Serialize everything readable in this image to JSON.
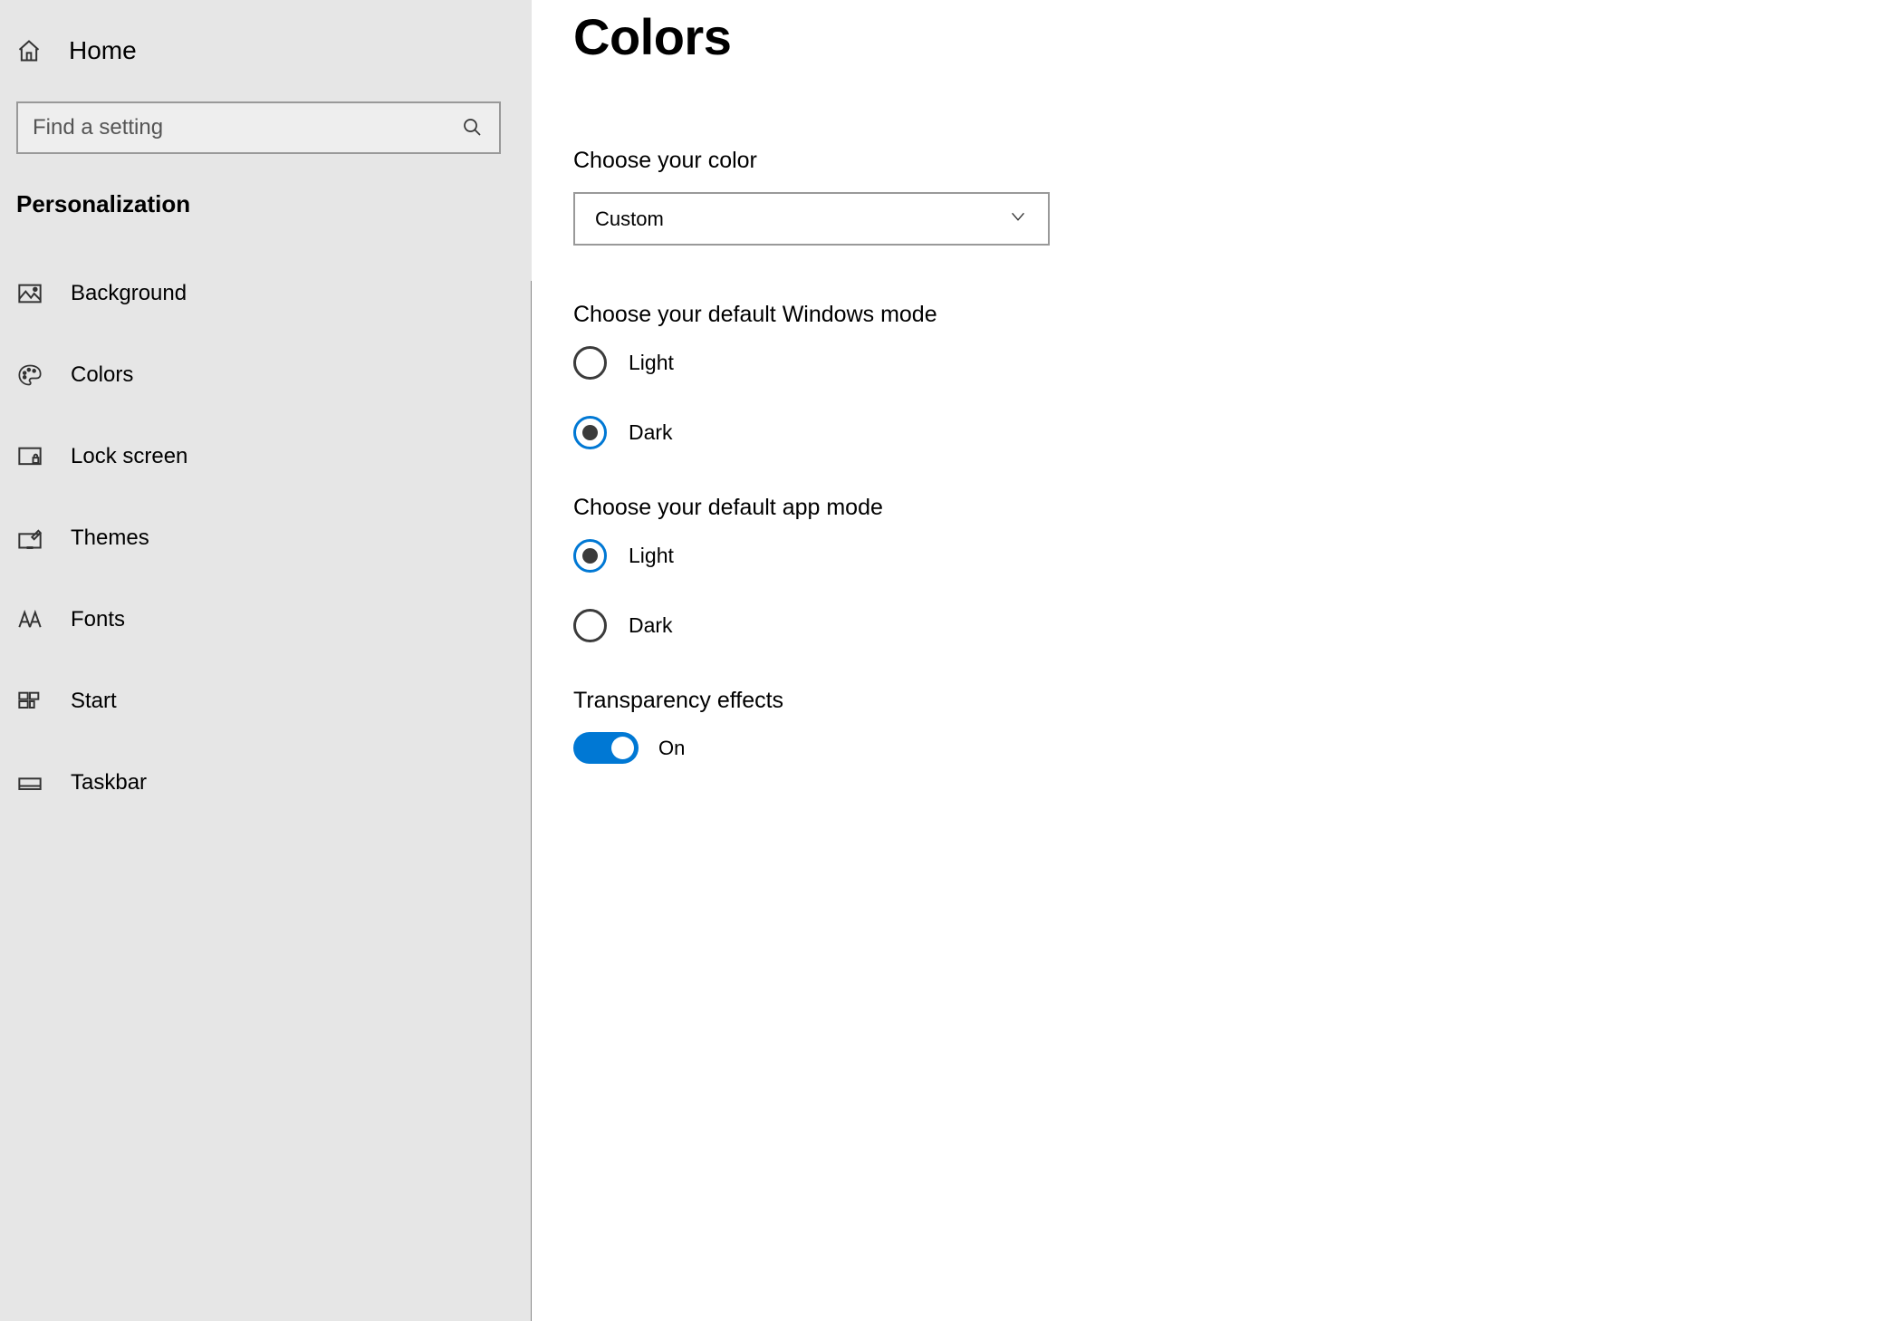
{
  "sidebar": {
    "home_label": "Home",
    "search_placeholder": "Find a setting",
    "section_title": "Personalization",
    "items": [
      {
        "label": "Background"
      },
      {
        "label": "Colors"
      },
      {
        "label": "Lock screen"
      },
      {
        "label": "Themes"
      },
      {
        "label": "Fonts"
      },
      {
        "label": "Start"
      },
      {
        "label": "Taskbar"
      }
    ]
  },
  "main": {
    "page_title": "Colors",
    "choose_color_label": "Choose your color",
    "choose_color_value": "Custom",
    "windows_mode": {
      "label": "Choose your default Windows mode",
      "options": [
        {
          "label": "Light",
          "selected": false
        },
        {
          "label": "Dark",
          "selected": true
        }
      ]
    },
    "app_mode": {
      "label": "Choose your default app mode",
      "options": [
        {
          "label": "Light",
          "selected": true
        },
        {
          "label": "Dark",
          "selected": false
        }
      ]
    },
    "transparency": {
      "label": "Transparency effects",
      "state_label": "On",
      "on": true
    }
  }
}
